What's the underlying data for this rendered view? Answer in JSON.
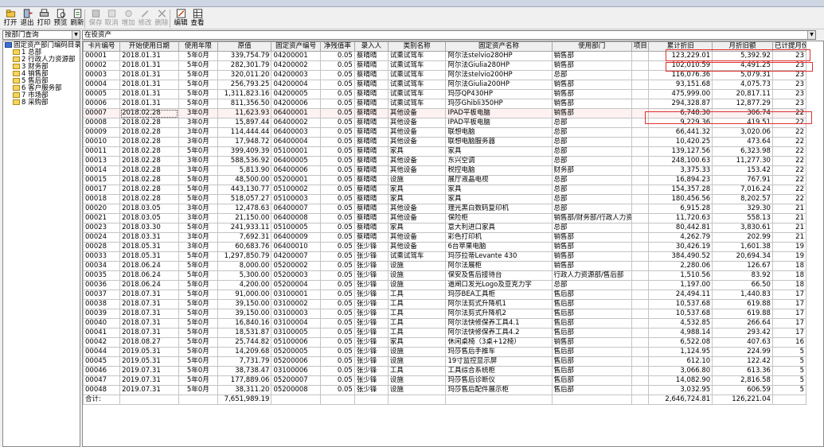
{
  "toolbar": {
    "buttons": [
      {
        "label": "打开",
        "icon": "open-folder-icon",
        "enabled": true
      },
      {
        "label": "退出",
        "icon": "exit-door-icon",
        "enabled": true
      },
      {
        "label": "打印",
        "icon": "printer-icon",
        "enabled": true
      },
      {
        "label": "预览",
        "icon": "preview-icon",
        "enabled": true
      },
      {
        "label": "刷新",
        "icon": "refresh-icon",
        "enabled": true
      },
      {
        "label": "保存",
        "icon": "save-disk-icon",
        "enabled": false
      },
      {
        "label": "取消",
        "icon": "cancel-icon",
        "enabled": false
      },
      {
        "label": "增加",
        "icon": "add-icon",
        "enabled": false
      },
      {
        "label": "修改",
        "icon": "edit-pencil-icon",
        "enabled": false
      },
      {
        "label": "删除",
        "icon": "delete-x-icon",
        "enabled": false
      },
      {
        "label": "编辑",
        "icon": "edit-grid-icon",
        "enabled": true
      },
      {
        "label": "查看",
        "icon": "view-grid-icon",
        "enabled": true
      }
    ]
  },
  "filter": {
    "left_value": "按部门查询",
    "right_value": "在役资产"
  },
  "tree": {
    "root": "固定资产部门编码目录",
    "items": [
      "1 总部",
      "2 行政人力资源部",
      "3 财务部",
      "4 销售部",
      "5 售后部",
      "6 客户服务部",
      "7 市场部",
      "8 采购部"
    ]
  },
  "table": {
    "columns": [
      "卡片编号",
      "开始使用日期",
      "使用年限",
      "原值",
      "固定资产编号",
      "净残值率",
      "录入人",
      "类别名称",
      "固定资产名称",
      "使用部门",
      "项目",
      "累计折旧",
      "月折旧额",
      "已计提月份"
    ],
    "rows": [
      [
        "00001",
        "2018.01.31",
        "5年0月",
        "339,754.79",
        "04200001",
        "0.05",
        "蔡晴晴",
        "试乘试驾车",
        "阿尔法stelvio280HP",
        "销售部",
        "",
        "123,229.01",
        "5,392.92",
        "23"
      ],
      [
        "00002",
        "2018.01.31",
        "5年0月",
        "282,301.79",
        "04200002",
        "0.05",
        "蔡晴晴",
        "试乘试驾车",
        "阿尔法Giulia280HP",
        "销售部",
        "",
        "102,010.59",
        "4,491.25",
        "23"
      ],
      [
        "00003",
        "2018.01.31",
        "5年0月",
        "320,011.20",
        "04200003",
        "0.05",
        "蔡晴晴",
        "试乘试驾车",
        "阿尔法stelvio200HP",
        "总部",
        "",
        "116,076.36",
        "5,079.31",
        "23"
      ],
      [
        "00004",
        "2018.01.31",
        "5年0月",
        "256,793.25",
        "04200004",
        "0.05",
        "蔡晴晴",
        "试乘试驾车",
        "阿尔法Giulia200HP",
        "销售部",
        "",
        "93,151.68",
        "4,075.73",
        "23"
      ],
      [
        "00005",
        "2018.01.31",
        "5年0月",
        "1,311,823.16",
        "04200005",
        "0.05",
        "蔡晴晴",
        "试乘试驾车",
        "玛莎QP430HP",
        "销售部",
        "",
        "475,999.00",
        "20,817.11",
        "23"
      ],
      [
        "00006",
        "2018.01.31",
        "5年0月",
        "811,356.50",
        "04200006",
        "0.05",
        "蔡晴晴",
        "试乘试驾车",
        "玛莎Ghibli350HP",
        "销售部",
        "",
        "294,328.87",
        "12,877.29",
        "23"
      ],
      [
        "00007",
        "2018.02.28",
        "3年0月",
        "11,623.93",
        "06400001",
        "0.05",
        "蔡晴晴",
        "其他设备",
        "IPAD平板电脑",
        "销售部",
        "",
        "6,748.30",
        "306.74",
        "22"
      ],
      [
        "00008",
        "2018.02.28",
        "3年0月",
        "15,897.44",
        "06400002",
        "0.05",
        "蔡晴晴",
        "其他设备",
        "IPAD平板电脑",
        "总部",
        "",
        "9,229.36",
        "419.51",
        "22"
      ],
      [
        "00009",
        "2018.02.28",
        "3年0月",
        "114,444.44",
        "06400003",
        "0.05",
        "蔡晴晴",
        "其他设备",
        "联想电脑",
        "总部",
        "",
        "66,441.32",
        "3,020.06",
        "22"
      ],
      [
        "00010",
        "2018.02.28",
        "3年0月",
        "17,948.72",
        "06400004",
        "0.05",
        "蔡晴晴",
        "其他设备",
        "联想电脑服务器",
        "总部",
        "",
        "10,420.25",
        "473.64",
        "22"
      ],
      [
        "00011",
        "2018.02.28",
        "5年0月",
        "399,409.39",
        "05100001",
        "0.05",
        "蔡晴晴",
        "家具",
        "家具",
        "总部",
        "",
        "139,127.56",
        "6,323.98",
        "22"
      ],
      [
        "00013",
        "2018.02.28",
        "3年0月",
        "588,536.92",
        "06400005",
        "0.05",
        "蔡晴晴",
        "其他设备",
        "东兴空调",
        "总部",
        "",
        "248,100.63",
        "11,277.30",
        "22"
      ],
      [
        "00014",
        "2018.02.28",
        "3年0月",
        "5,813.90",
        "06400006",
        "0.05",
        "蔡晴晴",
        "其他设备",
        "税控电脑",
        "财务部",
        "",
        "3,375.33",
        "153.42",
        "22"
      ],
      [
        "00015",
        "2018.02.28",
        "5年0月",
        "48,500.00",
        "05200001",
        "0.05",
        "蔡晴晴",
        "设施",
        "展厅液晶电视",
        "总部",
        "",
        "16,894.23",
        "767.91",
        "22"
      ],
      [
        "00017",
        "2018.02.28",
        "5年0月",
        "443,130.77",
        "05100002",
        "0.05",
        "蔡晴晴",
        "家具",
        "家具",
        "总部",
        "",
        "154,357.28",
        "7,016.24",
        "22"
      ],
      [
        "00018",
        "2018.02.28",
        "5年0月",
        "518,057.27",
        "05100003",
        "0.05",
        "蔡晴晴",
        "家具",
        "家具",
        "总部",
        "",
        "180,456.56",
        "8,202.57",
        "22"
      ],
      [
        "00020",
        "2018.03.05",
        "3年0月",
        "12,478.63",
        "06400007",
        "0.05",
        "蔡晴晴",
        "其他设备",
        "理光黑白数码复印机",
        "总部",
        "",
        "6,915.28",
        "329.30",
        "21"
      ],
      [
        "00021",
        "2018.03.05",
        "3年0月",
        "21,150.00",
        "06400008",
        "0.05",
        "蔡晴晴",
        "其他设备",
        "保险柜",
        "销售部/财务部/行政人力资",
        "",
        "11,720.63",
        "558.13",
        "21"
      ],
      [
        "00023",
        "2018.03.30",
        "5年0月",
        "241,933.11",
        "05100005",
        "0.05",
        "蔡晴晴",
        "家具",
        "意大利进口家具",
        "总部",
        "",
        "80,442.81",
        "3,830.61",
        "21"
      ],
      [
        "00024",
        "2018.03.31",
        "3年0月",
        "7,692.31",
        "06400009",
        "0.05",
        "蔡晴晴",
        "其他设备",
        "彩色打印机",
        "销售部",
        "",
        "4,262.79",
        "202.99",
        "21"
      ],
      [
        "00028",
        "2018.05.31",
        "3年0月",
        "60,683.76",
        "06400010",
        "0.05",
        "张少锋",
        "其他设备",
        "6台苹果电脑",
        "销售部",
        "",
        "30,426.19",
        "1,601.38",
        "19"
      ],
      [
        "00033",
        "2018.05.31",
        "5年0月",
        "1,297,850.79",
        "04200007",
        "0.05",
        "张少锋",
        "试乘试驾车",
        "玛莎拉蒂Levante 430",
        "销售部",
        "",
        "384,490.52",
        "20,694.34",
        "19"
      ],
      [
        "00034",
        "2018.06.24",
        "5年0月",
        "8,000.00",
        "05200002",
        "0.05",
        "张少锋",
        "设施",
        "阿尔法展柜",
        "销售部",
        "",
        "2,280.06",
        "126.67",
        "18"
      ],
      [
        "00035",
        "2018.06.24",
        "5年0月",
        "5,300.00",
        "05200003",
        "0.05",
        "张少锋",
        "设施",
        "保安及售后接待台",
        "行政人力资源部/售后部",
        "",
        "1,510.56",
        "83.92",
        "18"
      ],
      [
        "00036",
        "2018.06.24",
        "5年0月",
        "4,200.00",
        "05200004",
        "0.05",
        "张少锋",
        "设施",
        "道闸口发光Logo及亚克力字",
        "总部",
        "",
        "1,197.00",
        "66.50",
        "18"
      ],
      [
        "00037",
        "2018.07.31",
        "5年0月",
        "91,000.00",
        "03100001",
        "0.05",
        "张少锋",
        "工具",
        "玛莎BEA工具柜",
        "售后部",
        "",
        "24,494.11",
        "1,440.83",
        "17"
      ],
      [
        "00038",
        "2018.07.31",
        "5年0月",
        "39,150.00",
        "03100002",
        "0.05",
        "张少锋",
        "工具",
        "阿尔法剪式升降机1",
        "售后部",
        "",
        "10,537.68",
        "619.88",
        "17"
      ],
      [
        "00039",
        "2018.07.31",
        "5年0月",
        "39,150.00",
        "03100003",
        "0.05",
        "张少锋",
        "工具",
        "阿尔法剪式升降机2",
        "售后部",
        "",
        "10,537.68",
        "619.88",
        "17"
      ],
      [
        "00040",
        "2018.07.31",
        "5年0月",
        "16,840.16",
        "03100004",
        "0.05",
        "张少锋",
        "工具",
        "阿尔法快修保养工具4.1",
        "售后部",
        "",
        "4,532.85",
        "266.64",
        "17"
      ],
      [
        "00041",
        "2018.07.31",
        "5年0月",
        "18,531.87",
        "03100005",
        "0.05",
        "张少锋",
        "工具",
        "阿尔法快修保养工具4.2",
        "售后部",
        "",
        "4,988.14",
        "293.42",
        "17"
      ],
      [
        "00042",
        "2018.08.27",
        "5年0月",
        "25,744.82",
        "05100006",
        "0.05",
        "张少锋",
        "家具",
        "休闲桌椅（3桌+12椅）",
        "销售部",
        "",
        "6,522.08",
        "407.63",
        "16"
      ],
      [
        "00044",
        "2019.05.31",
        "5年0月",
        "14,209.68",
        "05200005",
        "0.05",
        "张少锋",
        "设施",
        "玛莎售后手推车",
        "售后部",
        "",
        "1,124.95",
        "224.99",
        "5"
      ],
      [
        "00045",
        "2019.05.31",
        "5年0月",
        "7,731.79",
        "05200006",
        "0.05",
        "张少锋",
        "设施",
        "19寸监控显示屏",
        "售后部",
        "",
        "612.10",
        "122.42",
        "5"
      ],
      [
        "00046",
        "2019.07.31",
        "5年0月",
        "38,738.47",
        "03100006",
        "0.05",
        "张少锋",
        "工具",
        "工具综合系统柜",
        "售后部",
        "",
        "3,066.80",
        "613.36",
        "5"
      ],
      [
        "00047",
        "2019.07.31",
        "5年0月",
        "177,889.06",
        "05200007",
        "0.05",
        "张少锋",
        "设施",
        "玛莎售后诊断仪",
        "售后部",
        "",
        "14,082.90",
        "2,816.58",
        "5"
      ],
      [
        "00048",
        "2019.07.31",
        "5年0月",
        "38,311.20",
        "05200008",
        "0.05",
        "张少锋",
        "设施",
        "玛莎售后配件展示柜",
        "售后部",
        "",
        "3,032.95",
        "606.59",
        "5"
      ]
    ],
    "total": {
      "label": "合计:",
      "original_value": "7,651,989.19",
      "accumulated": "2,646,724.81",
      "monthly": "126,221.04"
    }
  }
}
